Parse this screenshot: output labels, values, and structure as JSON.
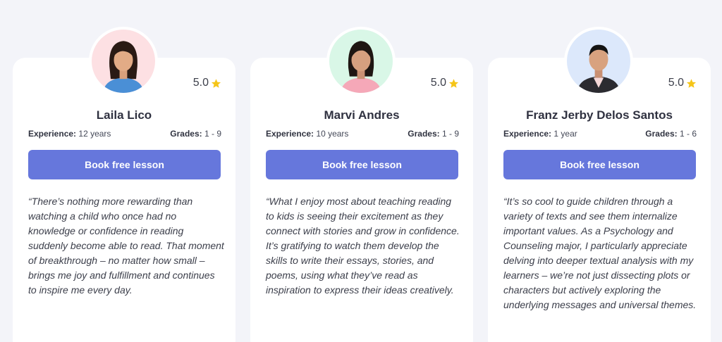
{
  "colors": {
    "button": "#6677dc",
    "star": "#f5c518",
    "background": "#f3f4f9",
    "card": "#ffffff"
  },
  "tutors": [
    {
      "name": "Laila Lico",
      "rating": "5.0",
      "experience_label": "Experience:",
      "experience": "12 years",
      "grades_label": "Grades:",
      "grades": "1 - 9",
      "button_label": "Book free lesson",
      "quote": "“There’s nothing more rewarding than watching a child who once had no knowledge or confidence in reading suddenly become able to read. That moment of breakthrough – no matter how small – brings me joy and fulfillment and continues to inspire me every day.",
      "avatar_bg": "#fde0e3"
    },
    {
      "name": "Marvi Andres",
      "rating": "5.0",
      "experience_label": "Experience:",
      "experience": "10 years",
      "grades_label": "Grades:",
      "grades": "1 - 9",
      "button_label": "Book free lesson",
      "quote": "“What I enjoy most about teaching reading to kids is seeing their excitement as they connect with stories and grow in confidence. It’s gratifying to watch them develop the skills to write their essays, stories, and poems, using what they’ve read as inspiration to express their ideas creatively.",
      "avatar_bg": "#d9f7e7"
    },
    {
      "name": "Franz Jerby Delos Santos",
      "rating": "5.0",
      "experience_label": "Experience:",
      "experience": "1 year",
      "grades_label": "Grades:",
      "grades": "1 - 6",
      "button_label": "Book free lesson",
      "quote": "“It’s so cool to guide children through a variety of texts and see them internalize important values. As a Psychology and Counseling major, I particularly appreciate delving into deeper textual analysis with my learners – we’re not just dissecting plots or characters but actively exploring the underlying messages and universal themes.",
      "avatar_bg": "#dce8fb"
    }
  ]
}
